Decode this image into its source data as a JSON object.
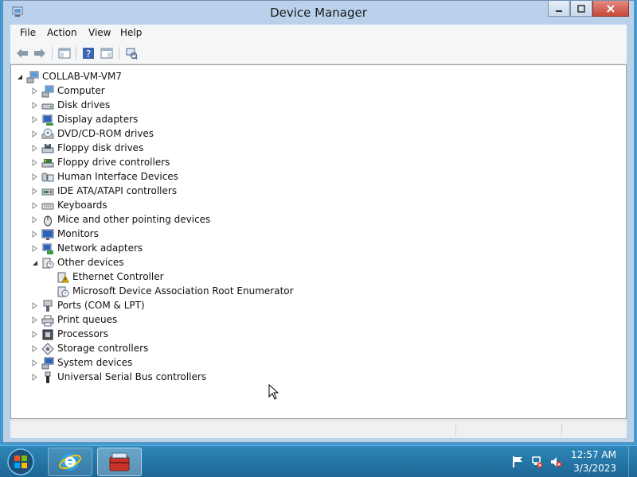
{
  "window": {
    "title": "Device Manager"
  },
  "menu": {
    "items": [
      "File",
      "Action",
      "View",
      "Help"
    ]
  },
  "toolbar": {
    "buttons": [
      "back-arrow-icon",
      "forward-arrow-icon",
      "console-tree-icon",
      "help-icon",
      "properties-icon",
      "scan-hardware-icon"
    ]
  },
  "tree": {
    "root": {
      "label": "COLLAB-VM-VM7",
      "expanded": true,
      "icon": "computer-icon"
    },
    "categories": [
      {
        "label": "Computer",
        "expanded": false,
        "icon": "computer-icon"
      },
      {
        "label": "Disk drives",
        "expanded": false,
        "icon": "disk-drive-icon"
      },
      {
        "label": "Display adapters",
        "expanded": false,
        "icon": "display-adapter-icon"
      },
      {
        "label": "DVD/CD-ROM drives",
        "expanded": false,
        "icon": "dvd-drive-icon"
      },
      {
        "label": "Floppy disk drives",
        "expanded": false,
        "icon": "floppy-drive-icon"
      },
      {
        "label": "Floppy drive controllers",
        "expanded": false,
        "icon": "floppy-controller-icon"
      },
      {
        "label": "Human Interface Devices",
        "expanded": false,
        "icon": "hid-icon"
      },
      {
        "label": "IDE ATA/ATAPI controllers",
        "expanded": false,
        "icon": "ide-controller-icon"
      },
      {
        "label": "Keyboards",
        "expanded": false,
        "icon": "keyboard-icon"
      },
      {
        "label": "Mice and other pointing devices",
        "expanded": false,
        "icon": "mouse-icon"
      },
      {
        "label": "Monitors",
        "expanded": false,
        "icon": "monitor-icon"
      },
      {
        "label": "Network adapters",
        "expanded": false,
        "icon": "network-adapter-icon"
      },
      {
        "label": "Other devices",
        "expanded": true,
        "icon": "unknown-device-icon"
      },
      {
        "label": "Ports (COM & LPT)",
        "expanded": false,
        "icon": "port-icon"
      },
      {
        "label": "Print queues",
        "expanded": false,
        "icon": "printer-icon"
      },
      {
        "label": "Processors",
        "expanded": false,
        "icon": "processor-icon"
      },
      {
        "label": "Storage controllers",
        "expanded": false,
        "icon": "storage-controller-icon"
      },
      {
        "label": "System devices",
        "expanded": false,
        "icon": "system-device-icon"
      },
      {
        "label": "Universal Serial Bus controllers",
        "expanded": false,
        "icon": "usb-icon"
      }
    ],
    "other_devices_children": [
      {
        "label": "Ethernet Controller",
        "icon": "warning-device-icon"
      },
      {
        "label": "Microsoft Device Association Root Enumerator",
        "icon": "unknown-device-icon"
      }
    ]
  },
  "taskbar": {
    "clock_time": "12:57 AM",
    "clock_date": "3/3/2023",
    "pinned": [
      "internet-explorer-icon",
      "device-manager-icon"
    ],
    "tray": [
      "flag-icon",
      "network-icon",
      "volume-muted-icon"
    ]
  },
  "colors": {
    "accent": "#2b8cc4",
    "window_frame": "#b9d1ea",
    "close_button": "#c7493a",
    "warning": "#f2c200"
  }
}
